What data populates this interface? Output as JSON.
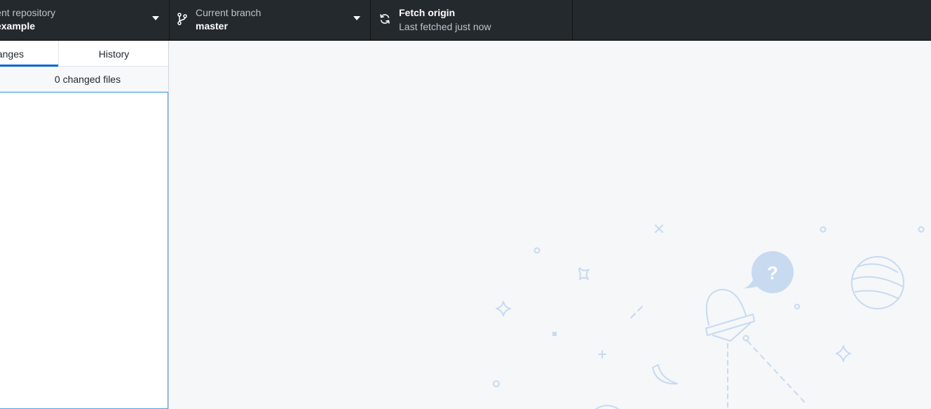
{
  "toolbar": {
    "repository": {
      "label": "Current repository",
      "value": "desktop-tutorial-example"
    },
    "branch": {
      "label": "Current branch",
      "value": "master"
    },
    "fetch": {
      "label": "Fetch origin",
      "sub": "Last fetched just now"
    }
  },
  "sidebar": {
    "tabs": [
      {
        "label": "Changes",
        "selected": true
      },
      {
        "label": "History",
        "selected": false
      }
    ],
    "changed_files": "0 changed files"
  },
  "colors": {
    "toolbar_bg": "#24292e",
    "accent": "#0366d6",
    "illustration": "#c8daf0"
  },
  "icons": {
    "repository_caret": "caret-down-icon",
    "branch": "git-branch-icon",
    "branch_caret": "caret-down-icon",
    "fetch": "sync-icon"
  }
}
